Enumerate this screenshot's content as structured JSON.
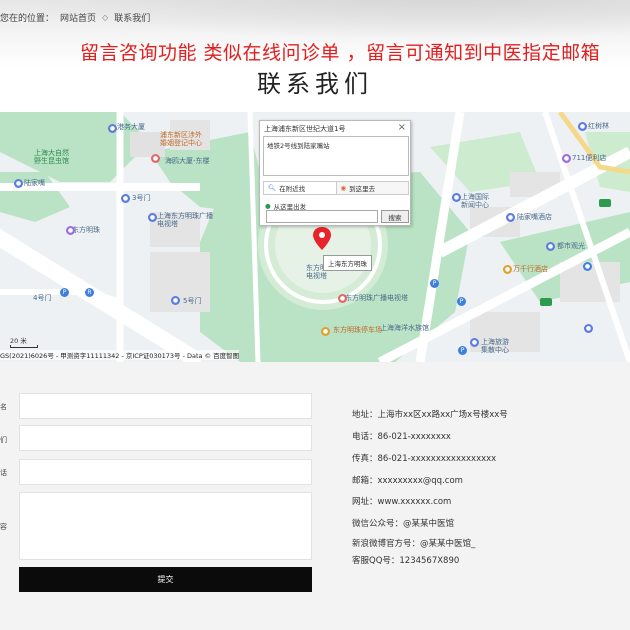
{
  "breadcrumb": {
    "prefix": "您在的位置：",
    "home": "网站首页",
    "current": "联系我们"
  },
  "notice": "留言咨询功能 类似在线问诊单 ，留言可通知到中医指定邮箱",
  "page_title": "联系我们",
  "map": {
    "infowindow": {
      "title": "上海浦东新区世纪大道1号",
      "text": "地铁2号线到陆家嘴站",
      "tab_nearby": "在附近找",
      "tab_go": "到这里去",
      "from_here": "从这里出发",
      "search_button": "搜索"
    },
    "marker_label": "上海东方明珠",
    "scale": "20 米",
    "copyright": "GS(2021)6026号 - 甲测资字11111342 - 京ICP证030173号 - Data © 百度智图",
    "pois": [
      "港务大厦",
      "浦东新区涉外\n婚姻登记中心",
      "上海大自然\n野生昆虫馆",
      "海鸥大厦-东楼",
      "陆家嘴",
      "上海东方明珠广播\n电视塔",
      "东方明珠",
      "东方明珠广播\n电视塔",
      "东方明珠广播电视塔",
      "5号门",
      "3号门",
      "4号门",
      "东方明珠停车场",
      "上海海洋水族馆",
      "上海国际\n新闻中心",
      "陆家嘴酒店",
      "都市观光",
      "万千行酒店",
      "上海旅游\n集散中心",
      "海鸥大厦",
      "711便利店",
      "世界一流",
      "上海国际新闻中心",
      "红树林",
      "正大广场",
      "东方明珠东门",
      "陆家嘴",
      "上海旅游咨询服务中心",
      "世纪公园",
      "陆家嘴",
      "东方明珠西门",
      "地铁站"
    ]
  },
  "form": {
    "labels": [
      "名",
      "们",
      "话",
      "容"
    ],
    "submit_label": "提交"
  },
  "contact": {
    "address": "地址：上海市xx区xx路xx广场x号楼xx号",
    "phone": "电话：86-021-xxxxxxxx",
    "fax": "传真：86-021-xxxxxxxxxxxxxxxxx",
    "email": "邮箱：xxxxxxxxx@qq.com",
    "website": "网址：www.xxxxxx.com",
    "wechat": "微信公众号：@某某中医馆",
    "weibo": "新浪微博官方号：@某某中医馆_",
    "qq": "客服QQ号：1234567X890"
  }
}
